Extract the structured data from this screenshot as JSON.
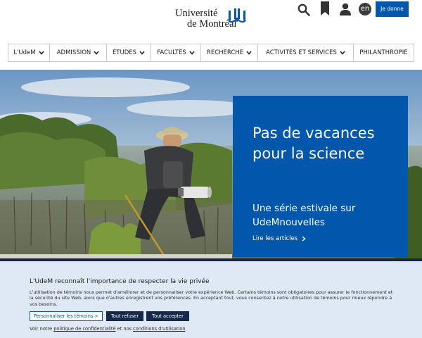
{
  "header": {
    "logo_line1": "Université",
    "logo_line2": "de Montréal",
    "search_icon": "search-icon",
    "bookmark_icon": "bookmark-icon",
    "user_icon": "user-icon",
    "lang_label": "en",
    "donate_label": "Je donne"
  },
  "nav": {
    "items": [
      {
        "label": "L'UdeM",
        "icon": "chevron-down-icon"
      },
      {
        "label": "ADMISSION",
        "icon": "chevron-down-icon"
      },
      {
        "label": "ÉTUDES",
        "icon": "chevron-down-icon"
      },
      {
        "label": "FACULTÉS",
        "icon": "chevron-down-icon"
      },
      {
        "label": "RECHERCHE",
        "icon": "chevron-down-icon"
      },
      {
        "label": "ACTIVITÉS ET SERVICES",
        "icon": "chevron-down-icon"
      },
      {
        "label": "PHILANTHROPIE",
        "icon": ""
      }
    ]
  },
  "hero": {
    "title": "Pas de vacances pour la science",
    "subtitle": "Une série estivale sur UdeMnouvelles",
    "link_label": "Lire les articles"
  },
  "cookie": {
    "title": "L'UdeM reconnaît l'importance de respecter la vie privée",
    "text": "L'utilisation de témoins nous permet d'améliorer et de personnaliser votre expérience Web. Certains témoins sont obligatoires pour assurer le fonctionnement et la sécurité du site Web, alors que d'autres enregistrent vos préférences. En acceptant tout, vous consentez à notre utilisation de témoins pour mieux répondre à vos besoins.",
    "personalize_label": "Personnaliser les témoins >",
    "refuse_label": "Tout refuser",
    "accept_label": "Tout accepter",
    "footer_prefix": "Voir notre",
    "privacy_link": "politique de confidentialité",
    "footer_and": "et nos",
    "terms_link": "conditions d'utilisation"
  },
  "colors": {
    "brand_blue": "#0057ac",
    "dark_navy": "#16284a",
    "cookie_bg": "#dfe9f5"
  }
}
